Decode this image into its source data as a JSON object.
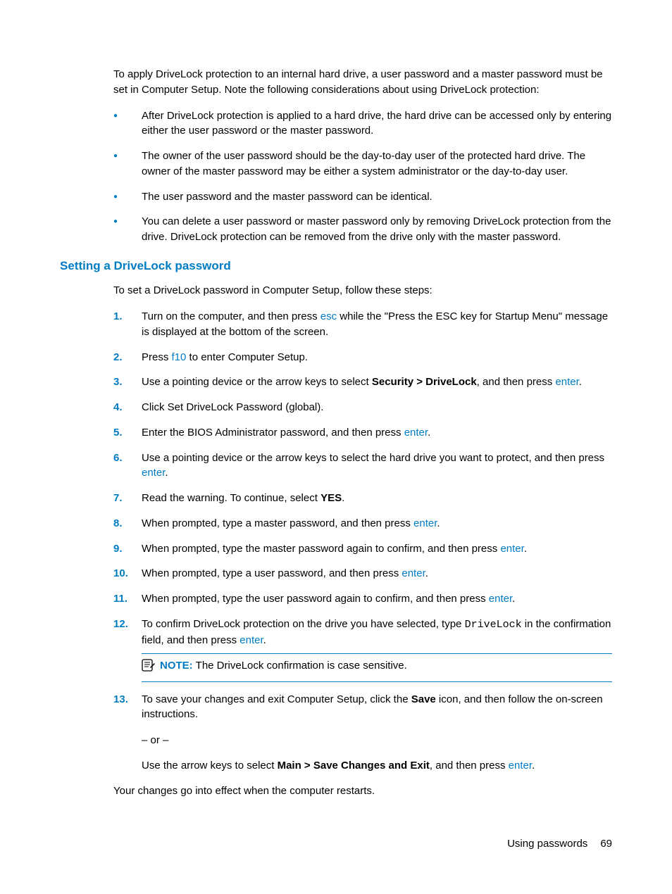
{
  "intro": "To apply DriveLock protection to an internal hard drive, a user password and a master password must be set in Computer Setup. Note the following considerations about using DriveLock protection:",
  "bullets": [
    "After DriveLock protection is applied to a hard drive, the hard drive can be accessed only by entering either the user password or the master password.",
    "The owner of the user password should be the day-to-day user of the protected hard drive. The owner of the master password may be either a system administrator or the day-to-day user.",
    "The user password and the master password can be identical.",
    "You can delete a user password or master password only by removing DriveLock protection from the drive. DriveLock protection can be removed from the drive only with the master password."
  ],
  "heading": "Setting a DriveLock password",
  "lead": "To set a DriveLock password in Computer Setup, follow these steps:",
  "steps": {
    "s1a": "Turn on the computer, and then press ",
    "s1k": "esc",
    "s1b": " while the \"Press the ESC key for Startup Menu\" message is displayed at the bottom of the screen.",
    "s2a": "Press ",
    "s2k": "f10",
    "s2b": " to enter Computer Setup.",
    "s3a": "Use a pointing device or the arrow keys to select ",
    "s3bold": "Security > DriveLock",
    "s3b": ", and then press ",
    "s3k": "enter",
    "s3c": ".",
    "s4": "Click Set DriveLock Password (global).",
    "s5a": "Enter the BIOS Administrator password, and then press ",
    "s5k": "enter",
    "s5b": ".",
    "s6a": "Use a pointing device or the arrow keys to select the hard drive you want to protect, and then press ",
    "s6k": "enter",
    "s6b": ".",
    "s7a": "Read the warning. To continue, select ",
    "s7bold": "YES",
    "s7b": ".",
    "s8a": "When prompted, type a master password, and then press ",
    "s8k": "enter",
    "s8b": ".",
    "s9a": "When prompted, type the master password again to confirm, and then press ",
    "s9k": "enter",
    "s9b": ".",
    "s10a": "When prompted, type a user password, and then press ",
    "s10k": "enter",
    "s10b": ".",
    "s11a": "When prompted, type the user password again to confirm, and then press ",
    "s11k": "enter",
    "s11b": ".",
    "s12a": "To confirm DriveLock protection on the drive you have selected, type ",
    "s12mono": "DriveLock",
    "s12b": " in the confirmation field, and then press ",
    "s12k": "enter",
    "s12c": ".",
    "s13a": "To save your changes and exit Computer Setup, click the ",
    "s13bold": "Save",
    "s13b": " icon, and then follow the on-screen instructions."
  },
  "note_label": "NOTE:",
  "note_text": "The DriveLock confirmation is case sensitive.",
  "or_text": "– or –",
  "alt_a": "Use the arrow keys to select ",
  "alt_bold": "Main > Save Changes and Exit",
  "alt_b": ", and then press ",
  "alt_k": "enter",
  "alt_c": ".",
  "closing": "Your changes go into effect when the computer restarts.",
  "footer_text": "Using passwords",
  "page_number": "69"
}
